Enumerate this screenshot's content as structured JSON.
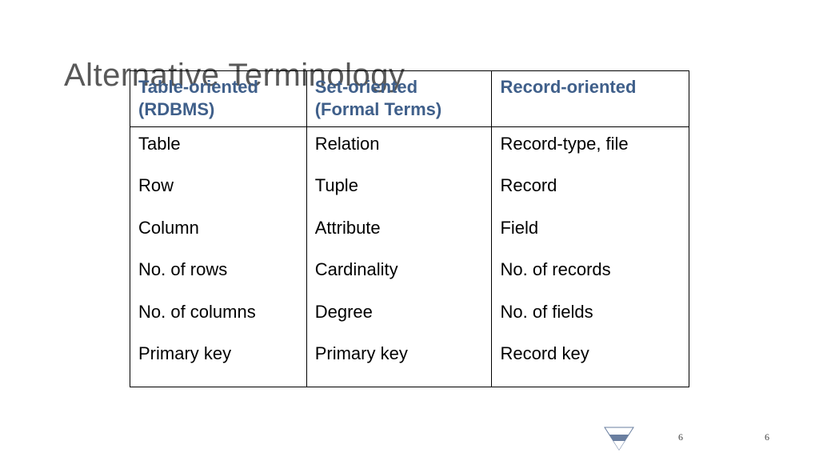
{
  "title": "Alternative Terminology",
  "headers": {
    "col1a": "Table-oriented",
    "col1b": "(RDBMS)",
    "col2a": "Set-oriented",
    "col2b": "(Formal Terms)",
    "col3a": "Record-oriented"
  },
  "rows": [
    {
      "c1": "Table",
      "c2": "Relation",
      "c3": "Record-type, file"
    },
    {
      "c1": "Row",
      "c2": "Tuple",
      "c3": "Record"
    },
    {
      "c1": "Column",
      "c2": "Attribute",
      "c3": "Field"
    },
    {
      "c1": "No. of rows",
      "c2": "Cardinality",
      "c3": "No. of records"
    },
    {
      "c1": "No. of columns",
      "c2": "Degree",
      "c3": "No. of fields"
    },
    {
      "c1": "Primary key",
      "c2": "Primary key",
      "c3": "Record key"
    }
  ],
  "pagenum": "6"
}
